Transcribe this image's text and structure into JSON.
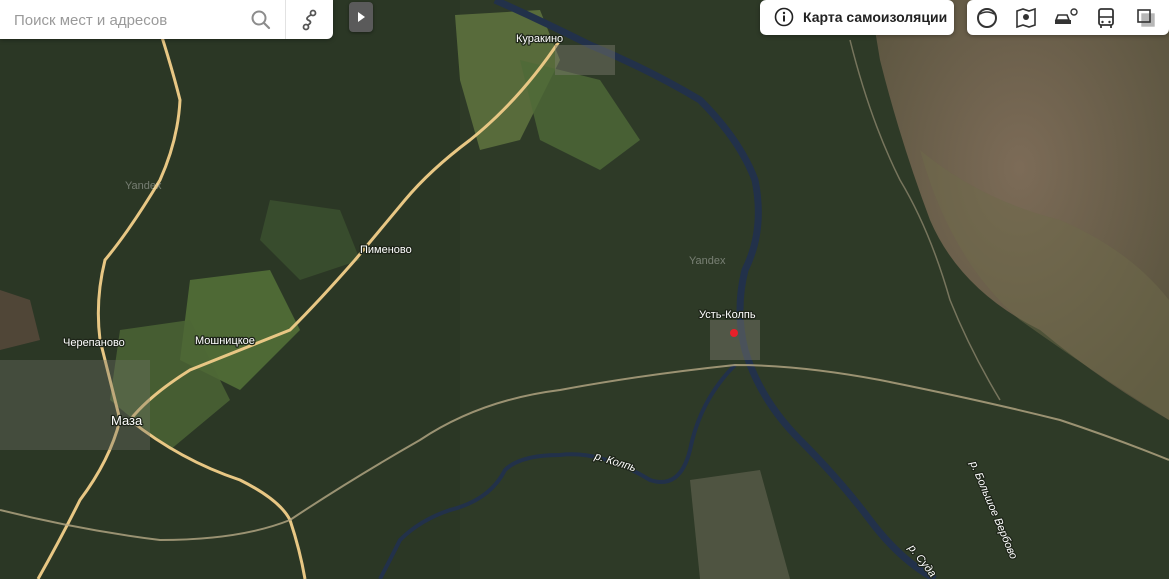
{
  "search": {
    "placeholder": "Поиск мест и адресов"
  },
  "toolbar": {
    "self_isolation_label": "Карта самоизоляции"
  },
  "layer_buttons": [
    {
      "name": "panorama-icon"
    },
    {
      "name": "map-layers-icon"
    },
    {
      "name": "traffic-icon"
    },
    {
      "name": "transit-icon"
    },
    {
      "name": "layers-switch-icon"
    }
  ],
  "map": {
    "watermark": "Yandex",
    "settlements": [
      "Куракино",
      "Пименово",
      "Черепаново",
      "Мошницкое",
      "Маза",
      "Усть-Колпь"
    ],
    "rivers": [
      "р. Колпь",
      "р. Суда",
      "р. Большое Вербово"
    ]
  },
  "colors": {
    "marker": "#e8202a",
    "road": "#e8c784",
    "river": "#22314a"
  }
}
